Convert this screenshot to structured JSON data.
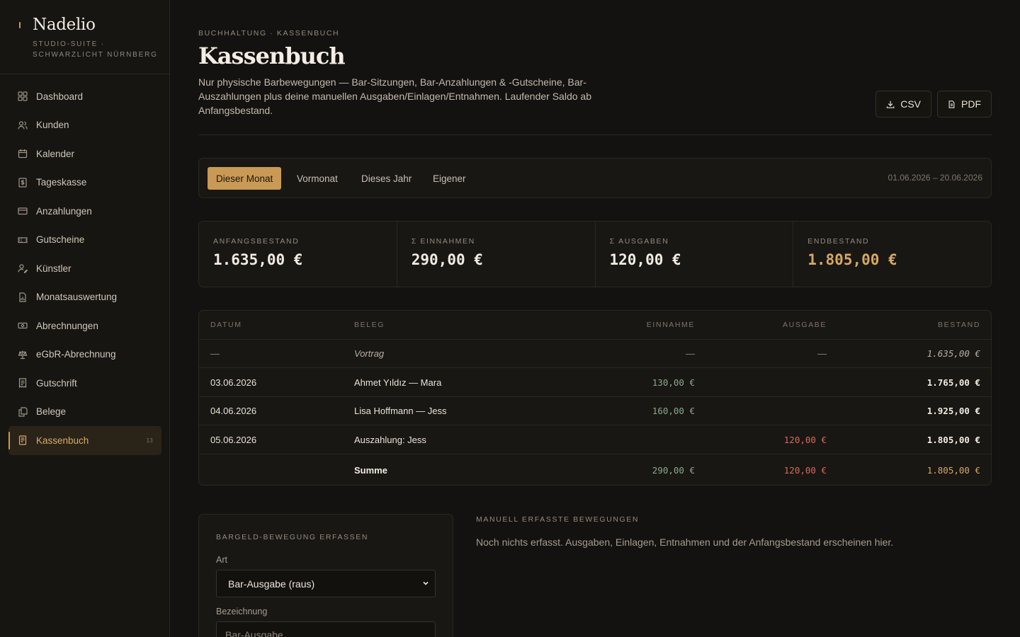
{
  "brand": {
    "name": "Nadelio",
    "subtitle": "STUDIO-SUITE · SCHWARZLICHT NÜRNBERG"
  },
  "sidebar": {
    "items": [
      {
        "label": "Dashboard",
        "icon": "dashboard-icon"
      },
      {
        "label": "Kunden",
        "icon": "users-icon"
      },
      {
        "label": "Kalender",
        "icon": "calendar-icon"
      },
      {
        "label": "Tageskasse",
        "icon": "cash-register-icon"
      },
      {
        "label": "Anzahlungen",
        "icon": "card-icon"
      },
      {
        "label": "Gutscheine",
        "icon": "ticket-icon"
      },
      {
        "label": "Künstler",
        "icon": "artist-icon"
      },
      {
        "label": "Monatsauswertung",
        "icon": "report-icon"
      },
      {
        "label": "Abrechnungen",
        "icon": "banknote-icon"
      },
      {
        "label": "eGbR-Abrechnung",
        "icon": "scale-icon"
      },
      {
        "label": "Gutschrift",
        "icon": "receipt-icon"
      },
      {
        "label": "Belege",
        "icon": "documents-icon"
      },
      {
        "label": "Kassenbuch",
        "icon": "book-icon",
        "active": true,
        "badge": "13"
      }
    ]
  },
  "header": {
    "breadcrumb": "BUCHHALTUNG · KASSENBUCH",
    "title": "Kassenbuch",
    "description": "Nur physische Barbewegungen — Bar-Sitzungen, Bar-Anzahlungen & -Gutscheine, Bar-Auszahlungen plus deine manuellen Ausgaben/Einlagen/Entnahmen. Laufender Saldo ab Anfangsbestand.",
    "csv_label": "CSV",
    "pdf_label": "PDF"
  },
  "period": {
    "tabs": [
      "Dieser Monat",
      "Vormonat",
      "Dieses Jahr",
      "Eigener"
    ],
    "active": "Dieser Monat",
    "range": "01.06.2026 – 20.06.2026"
  },
  "stats": [
    {
      "label": "ANFANGSBESTAND",
      "value": "1.635,00 €"
    },
    {
      "label": "Σ EINNAHMEN",
      "value": "290,00 €"
    },
    {
      "label": "Σ AUSGABEN",
      "value": "120,00 €"
    },
    {
      "label": "ENDBESTAND",
      "value": "1.805,00 €"
    }
  ],
  "table": {
    "headers": {
      "date": "DATUM",
      "beleg": "BELEG",
      "in": "EINNAHME",
      "out": "AUSGABE",
      "balance": "BESTAND"
    },
    "carry": {
      "date": "—",
      "beleg": "Vortrag",
      "in": "—",
      "out": "—",
      "balance": "1.635,00 €"
    },
    "rows": [
      {
        "date": "03.06.2026",
        "beleg": "Ahmet Yıldız — Mara",
        "in": "130,00 €",
        "out": "",
        "balance": "1.765,00 €"
      },
      {
        "date": "04.06.2026",
        "beleg": "Lisa Hoffmann — Jess",
        "in": "160,00 €",
        "out": "",
        "balance": "1.925,00 €"
      },
      {
        "date": "05.06.2026",
        "beleg": "Auszahlung: Jess",
        "in": "",
        "out": "120,00 €",
        "balance": "1.805,00 €"
      }
    ],
    "sum": {
      "label": "Summe",
      "in": "290,00 €",
      "out": "120,00 €",
      "balance": "1.805,00 €"
    }
  },
  "form": {
    "title": "BARGELD-BEWEGUNG ERFASSEN",
    "art_label": "Art",
    "art_value": "Bar-Ausgabe (raus)",
    "bezeichnung_label": "Bezeichnung",
    "bezeichnung_placeholder": "Bar-Ausgabe"
  },
  "manual": {
    "title": "MANUELL ERFASSTE BEWEGUNGEN",
    "empty": "Noch nichts erfasst. Ausgaben, Einlagen, Entnahmen und der Anfangsbestand erscheinen hier."
  },
  "colors": {
    "accent": "#c99a55",
    "income": "#8aa889",
    "expense": "#d46a5a",
    "background": "#141210"
  }
}
